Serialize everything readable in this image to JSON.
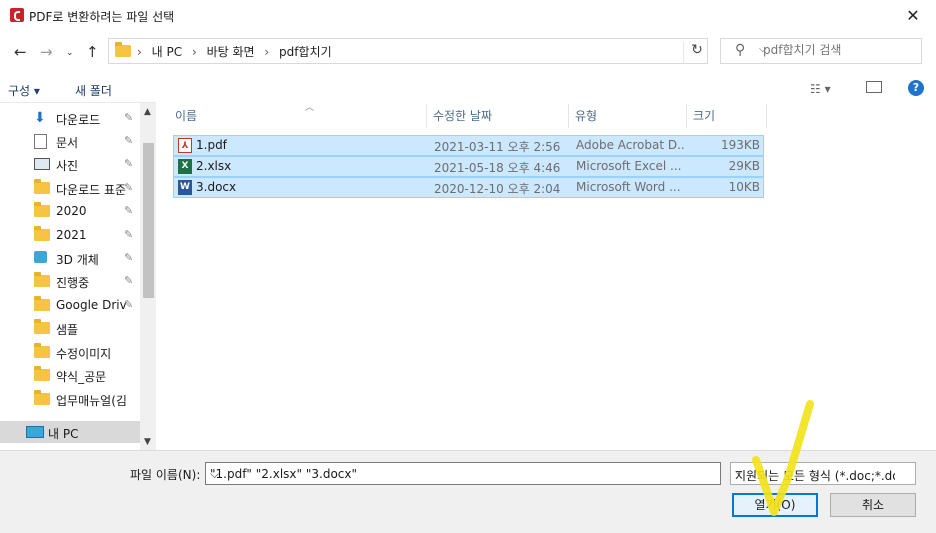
{
  "window": {
    "title": "PDF로 변환하려는 파일 선택",
    "close_glyph": "✕"
  },
  "nav": {
    "breadcrumb": [
      "내 PC",
      "바탕 화면",
      "pdf합치기"
    ],
    "search_placeholder": "pdf합치기 검색"
  },
  "toolbar": {
    "organize": "구성 ▾",
    "new_folder": "새 폴더",
    "help": "?"
  },
  "sidebar": {
    "items": [
      {
        "label": "다운로드",
        "icon": "download-arrow-icon",
        "pinned": true
      },
      {
        "label": "문서",
        "icon": "document-icon",
        "pinned": true
      },
      {
        "label": "사진",
        "icon": "pictures-icon",
        "pinned": true
      },
      {
        "label": "다운로드 표준",
        "icon": "folder-icon",
        "pinned": true
      },
      {
        "label": "2020",
        "icon": "folder-icon",
        "pinned": true
      },
      {
        "label": "2021",
        "icon": "folder-icon",
        "pinned": true
      },
      {
        "label": "3D 개체",
        "icon": "3d-objects-icon",
        "pinned": true
      },
      {
        "label": "진행중",
        "icon": "folder-icon",
        "pinned": true
      },
      {
        "label": "Google Drive",
        "icon": "folder-icon",
        "pinned": true
      },
      {
        "label": "샘플",
        "icon": "folder-icon",
        "pinned": false
      },
      {
        "label": "수정이미지",
        "icon": "folder-icon",
        "pinned": false
      },
      {
        "label": "약식_공문",
        "icon": "folder-icon",
        "pinned": false
      },
      {
        "label": "업무매뉴얼(김지",
        "icon": "folder-icon",
        "pinned": false
      },
      {
        "label": "내 PC",
        "icon": "computer-icon",
        "pinned": false,
        "selected": true
      }
    ]
  },
  "columns": {
    "name": "이름",
    "modified": "수정한 날짜",
    "type": "유형",
    "size": "크기"
  },
  "files": [
    {
      "name": "1.pdf",
      "icon": "pdf-file-icon",
      "modified": "2021-03-11 오후 2:56",
      "type": "Adobe Acrobat D...",
      "size": "193KB",
      "selected": true
    },
    {
      "name": "2.xlsx",
      "icon": "excel-file-icon",
      "modified": "2021-05-18 오후 4:46",
      "type": "Microsoft Excel ...",
      "size": "29KB",
      "selected": true
    },
    {
      "name": "3.docx",
      "icon": "word-file-icon",
      "modified": "2020-12-10 오후 2:04",
      "type": "Microsoft Word ...",
      "size": "10KB",
      "selected": true
    }
  ],
  "footer": {
    "filename_label": "파일 이름(N):",
    "filename_value": "\"1.pdf\" \"2.xlsx\" \"3.docx\"",
    "filetype_value": "지원되는 모든 형식 (*.doc;*.do",
    "open_button": "열기(O)",
    "cancel_button": "취소"
  },
  "colors": {
    "selection_fill": "#cce8ff",
    "selection_border": "#99d1ff",
    "accent": "#0078d7",
    "annotation": "#f2e21a"
  }
}
